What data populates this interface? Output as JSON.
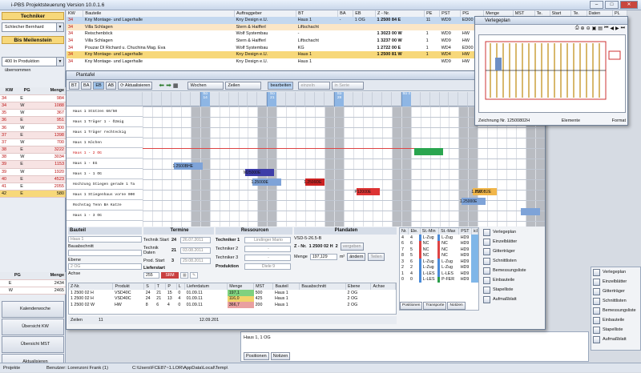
{
  "app": {
    "title": "i-PBS Projektsteuerung Version 10.0.1.6",
    "win_buttons": [
      "–",
      "□",
      "✕"
    ]
  },
  "left": {
    "role": "Techniker",
    "user": "Schlecher Bernhard",
    "milestone_label": "Bis Meilenstein",
    "milestone": "400 In Produktion übernommen",
    "kw_headers": [
      "KW",
      "PG",
      "Menge"
    ],
    "kw_rows": [
      [
        "34",
        "E",
        "984"
      ],
      [
        "34",
        "W",
        "1088"
      ],
      [
        "35",
        "W",
        "367"
      ],
      [
        "36",
        "E",
        "951"
      ],
      [
        "36",
        "W",
        "300"
      ],
      [
        "37",
        "E",
        "1398"
      ],
      [
        "37",
        "W",
        "700"
      ],
      [
        "38",
        "E",
        "3222"
      ],
      [
        "38",
        "W",
        "3034"
      ],
      [
        "39",
        "E",
        "1153"
      ],
      [
        "39",
        "W",
        "1920"
      ],
      [
        "40",
        "E",
        "4523"
      ],
      [
        "41",
        "E",
        "2055"
      ],
      [
        "42",
        "E",
        "580"
      ]
    ],
    "pg_headers": [
      "PG",
      "Menge"
    ],
    "pg_rows": [
      [
        "E",
        "2434"
      ],
      [
        "W",
        "2465"
      ]
    ],
    "buttons": [
      "Kalenderwoche",
      "Übersicht KW",
      "Übersicht MST",
      "Aktualisieren"
    ]
  },
  "main": {
    "headers": [
      "KW",
      "Bauteile",
      "Auftraggeber",
      "BT",
      "BA",
      "EB",
      "Z - Nr.",
      "PE",
      "PST",
      "PG",
      "Menge",
      "MST",
      "Te.",
      "Start",
      "Te.",
      "Daten",
      "PL"
    ],
    "rows": [
      [
        "34",
        "Kny Montage- und Lagerhalle",
        "Kny Design e.U.",
        "Haus 1",
        "-",
        "1 OG",
        "1 2500 84 E",
        "11",
        "WD9",
        "ED00",
        "19,00"
      ],
      [
        "34",
        "Villa Schlagen",
        "Stern & Haifferl",
        "Liftschacht",
        "",
        "",
        "",
        "",
        "",
        "",
        "200,00"
      ],
      [
        "34",
        "Reischenböck",
        "Wolf Systembau",
        "-",
        "",
        "",
        "1 3023 00 W",
        "1",
        "WD9",
        "HW",
        "291,48"
      ],
      [
        "34",
        "Villa Schlagen",
        "Stern & Haifferl",
        "Liftschacht",
        "",
        "",
        "1 3237 00 W",
        "1",
        "WD9",
        "HW",
        "66,97"
      ],
      [
        "34",
        "Pouzar DI Richard u. Chuchina Mag. Eva",
        "Wolf Systembau",
        "KG",
        "",
        "",
        "1 2722 00 E",
        "1",
        "WD4",
        "ED00",
        "66,97"
      ],
      [
        "34",
        "Kny Montage- und Lagerhalle",
        "Kny Design e.U.",
        "Haus 1",
        "",
        "",
        "1 2500 81 W",
        "1",
        "WD4",
        "HW",
        "494,01"
      ],
      [
        "34",
        "Kny Montage- und Lagerhalle",
        "Kny Design e.U.",
        "Haus 1",
        "",
        "",
        "",
        "",
        "WD9",
        "HW",
        "556,10"
      ]
    ]
  },
  "plantafel": {
    "title": "Plantafel",
    "toolbar": [
      "BT",
      "BA",
      "EB",
      "AB",
      "Aktualisieren",
      "Wochen",
      "Zeilen",
      "bearbeiten",
      "einzeln",
      "in Serie"
    ],
    "days": [
      "So 14",
      "So 21",
      "So 28",
      "So 4"
    ],
    "rows": [
      "Haus 1 Stützen 60/50",
      "Haus 1 Träger 1 - Ö2mig",
      "Haus 1 Träger rechteckig",
      "Haus 1 Köchen",
      "Haus 1 - 2 OG",
      "Haus 1 - EG",
      "Haus 1 - 1 OG",
      "Hochzung Stiegen gerade 1 Ta",
      "Haus 1 Stiegenhaus vorne 000",
      "Rochstag Tenn BA Katze",
      "Haus 1 - 3 OG"
    ],
    "bars": [
      "1.2500BHE",
      "M25000E",
      "1.25000E",
      "1.2599DE",
      "P12000E",
      "1.2500B2E",
      "1.25000E",
      "HW"
    ],
    "bauteil": {
      "label": "Bauteil",
      "value": "Haus 1",
      "abschnitt": "Bauabschnitt",
      "ebene": "Ebene",
      "ebene_val": "2 OG",
      "achse": "Achse"
    },
    "termine": {
      "label": "Termine",
      "rows": [
        [
          "Technik Start",
          "24",
          "26.07.2011"
        ],
        [
          "Technik Daten",
          "21",
          "03.08.2011"
        ],
        [
          "Prod. Start",
          "3",
          "29.08.2011"
        ]
      ],
      "lieferstart": "Lieferstart",
      "liefer_kw": "255",
      "liefer_state": "SRM"
    },
    "ressourcen": {
      "label": "Ressourcen",
      "rows": [
        [
          "Techniker 1",
          "Lindinger Mario"
        ],
        [
          "Techniker 2",
          "-"
        ],
        [
          "Techniker 3",
          "-"
        ]
      ],
      "produktion": "Produktion",
      "prod_val": "Diele 9"
    },
    "plandaten": {
      "label": "Plandaten",
      "code": "VSD-5-26.5-B",
      "znr_label": "Z - Nr.",
      "znr": "1 2500 02 H",
      "znr_n": "2",
      "vergeben": "vergeben",
      "menge_label": "Menge",
      "menge": "197,129",
      "unit": "m²",
      "aendern": "ändern",
      "teilen": "Teilen"
    },
    "detail_headers": [
      "Z-Nr.",
      "Produkt",
      "S",
      "T",
      "P",
      "L",
      "Lieferdatum",
      "Menge",
      "MST",
      "Bauteil",
      "Bauabschnitt",
      "Ebene",
      "Achse"
    ],
    "detail_rows": [
      [
        "1 2500 02 H",
        "VSD40C",
        "24",
        "21",
        "15",
        "0",
        "01.09.11",
        "197,1",
        "500",
        "Haus 1",
        "",
        "2 OG",
        ""
      ],
      [
        "1 2500 02 H",
        "VSD40C",
        "24",
        "21",
        "13",
        "4",
        "01.09.11",
        "116,0",
        "425",
        "Haus 1",
        "",
        "2 OG",
        ""
      ],
      [
        "1 2500 02 W",
        "HW",
        "8",
        "6",
        "4",
        "0",
        "01.09.11",
        "366,7",
        "200",
        "Haus 1",
        "",
        "2 OG",
        ""
      ]
    ],
    "footer_zeilen": "Zeilen",
    "footer_count": "11",
    "footer_date": "12.09.201",
    "pos_headers": [
      "Nr.",
      "Ele.",
      "St.-Min",
      "St.-Max",
      "PST",
      "icl"
    ],
    "pos_rows": [
      [
        "4",
        "4",
        "L-Zug",
        "L-Zug",
        "HD9"
      ],
      [
        "6",
        "6",
        "NC",
        "NC",
        "HD9"
      ],
      [
        "7",
        "5",
        "NC",
        "NC",
        "HD9"
      ],
      [
        "8",
        "5",
        "NC",
        "NC",
        "HD9"
      ],
      [
        "3",
        "6",
        "L-Zug",
        "L-Zug",
        "HD9"
      ],
      [
        "2",
        "2",
        "L-Zug",
        "L-Zug",
        "HD9"
      ],
      [
        "1",
        "4",
        "L-LES",
        "L-LES",
        "HD9"
      ],
      [
        "0",
        "0",
        "L-LES",
        "P-FER",
        "HD9"
      ]
    ],
    "pos_tabs": [
      "Positionen",
      "Transporte",
      "Notizen"
    ],
    "side": [
      "Verlegeplan",
      "Einzelblätter",
      "Gitterträger",
      "Schnittlisten",
      "Bemessungsliste",
      "Einbauteile",
      "Stapelliste",
      "Aufmaßblatt"
    ]
  },
  "verlegeplan": {
    "title": "Verlegeplan",
    "zeichnung": "Zeichnung Nr. 12500802H",
    "elemente": "Elemente",
    "format": "Format"
  },
  "right_side": [
    "Verlegeplan",
    "Einzelblätter",
    "Gitterträger",
    "Schnittlisten",
    "Bemessungsliste",
    "Einbauteile",
    "Stapelliste",
    "Aufmaßblatt"
  ],
  "under": {
    "text": "Haus 1, 1 OG",
    "tabs": [
      "Positionen",
      "Notizen"
    ]
  },
  "status": {
    "left": "Projekte",
    "user": "Benutzer: Lorenzoni Frank (1)",
    "path": "C:\\Users\\FCE87~1.LOR\\AppData\\Local\\Temp\\"
  }
}
